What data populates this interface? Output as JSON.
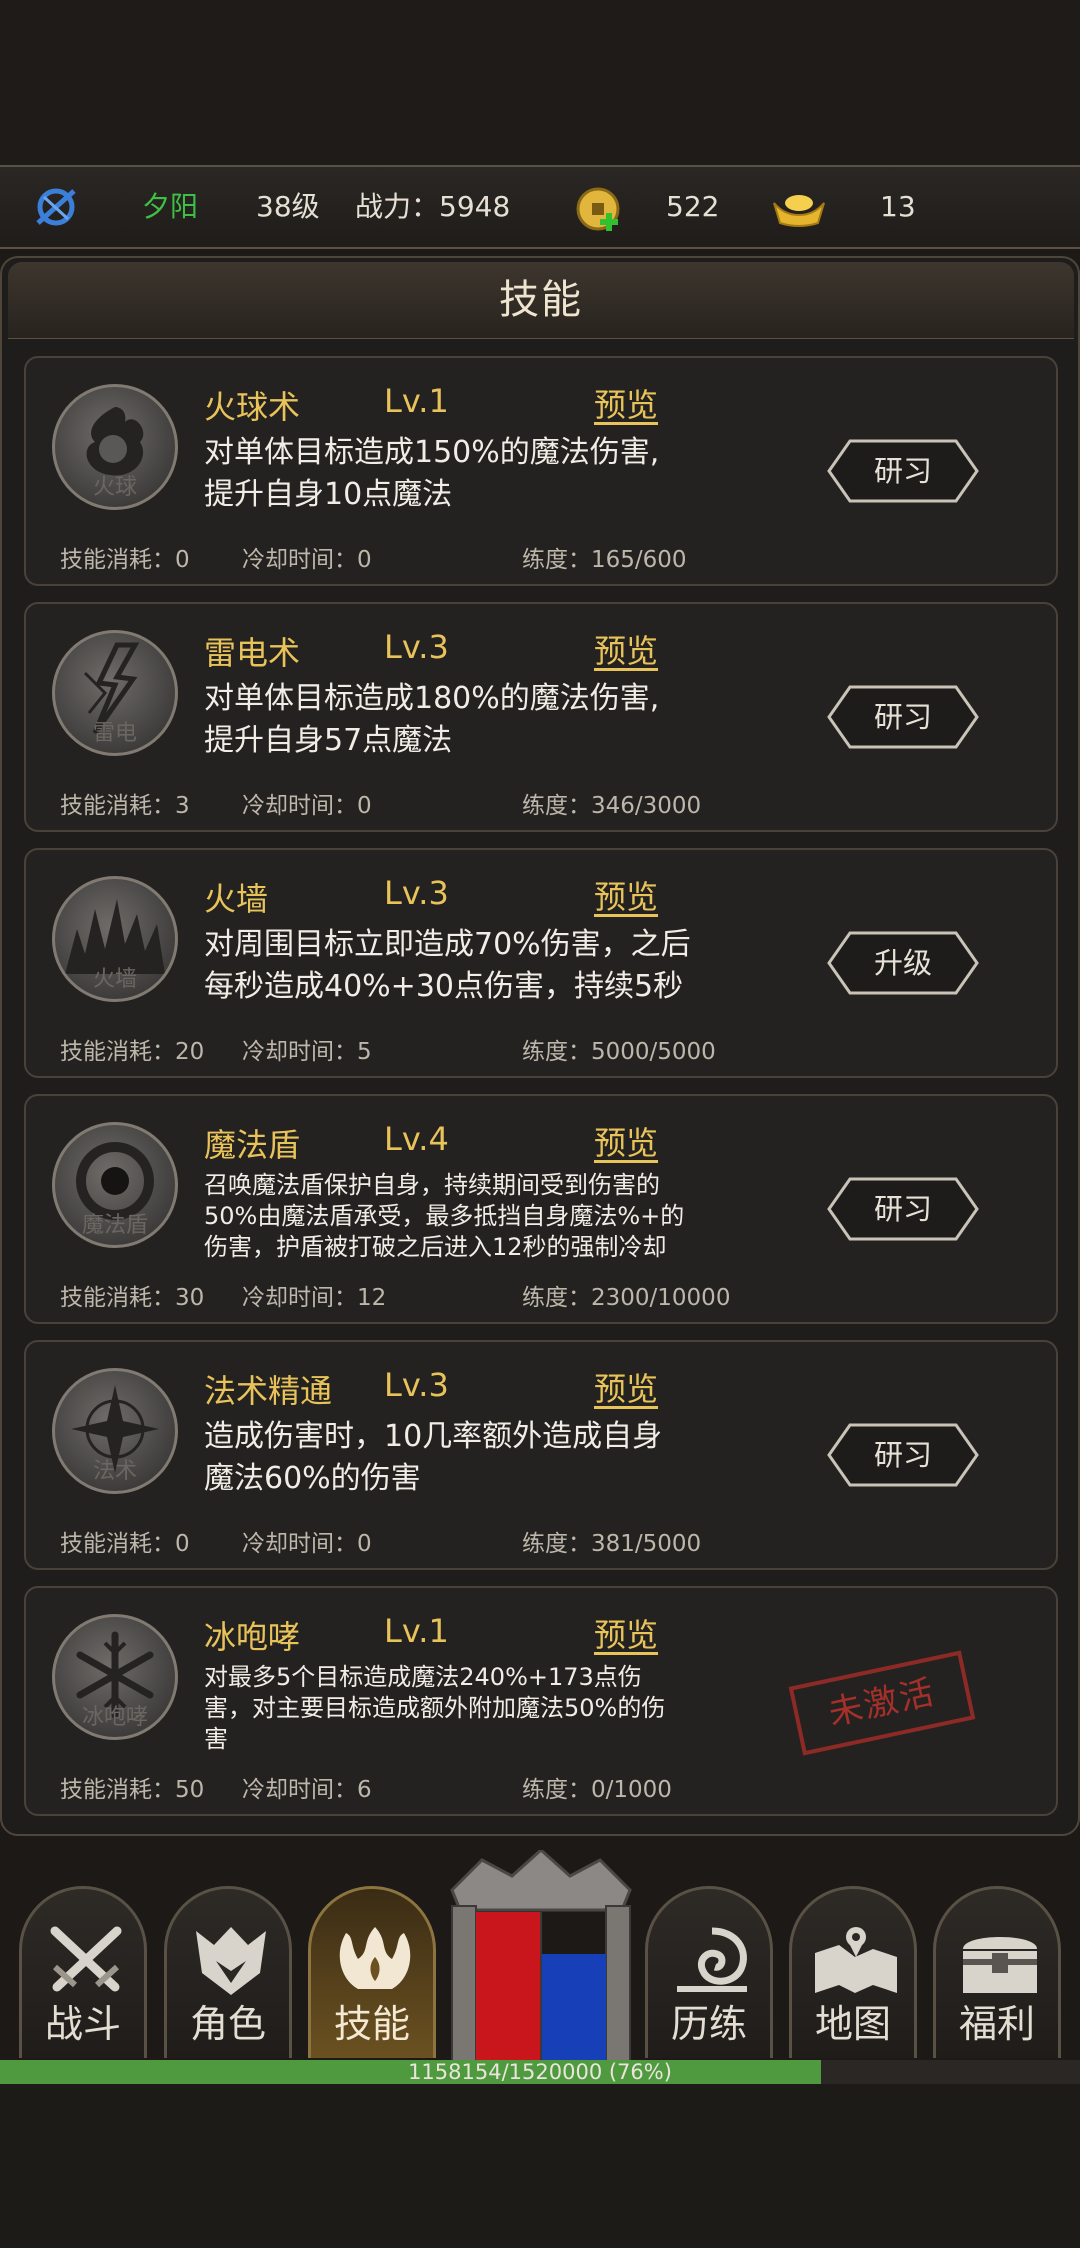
{
  "player": {
    "icon": "blue-crest-icon",
    "name": "夕阳",
    "level": "38级",
    "power_text": "战力：5948",
    "coins": "522",
    "ingots": "13"
  },
  "panel": {
    "title": "技能"
  },
  "skills": [
    {
      "name": "火球术",
      "level": "Lv.1",
      "preview": "预览",
      "icon_label": "火球",
      "icon": "fireball-icon",
      "desc_lines": [
        "对单体目标造成150%的魔法伤害,",
        "提升自身10点魔法"
      ],
      "cost": "技能消耗：0",
      "cooldown": "冷却时间：0",
      "proficiency": "练度：165/600",
      "action": "研习"
    },
    {
      "name": "雷电术",
      "level": "Lv.3",
      "preview": "预览",
      "icon_label": "雷电",
      "icon": "lightning-icon",
      "desc_lines": [
        "对单体目标造成180%的魔法伤害,",
        "提升自身57点魔法"
      ],
      "cost": "技能消耗：3",
      "cooldown": "冷却时间：0",
      "proficiency": "练度：346/3000",
      "action": "研习"
    },
    {
      "name": "火墙",
      "level": "Lv.3",
      "preview": "预览",
      "icon_label": "火墙",
      "icon": "firewall-icon",
      "desc_lines": [
        "对周围目标立即造成70%伤害，之后",
        "每秒造成40%+30点伤害，持续5秒"
      ],
      "cost": "技能消耗：20",
      "cooldown": "冷却时间：5",
      "proficiency": "练度：5000/5000",
      "action": "升级"
    },
    {
      "name": "魔法盾",
      "level": "Lv.4",
      "preview": "预览",
      "icon_label": "魔法盾",
      "icon": "magic-shield-icon",
      "desc_lines": [
        "召唤魔法盾保护自身，持续期间受到伤害的",
        "50%由魔法盾承受，最多抵挡自身魔法%+的",
        "伤害，护盾被打破之后进入12秒的强制冷却"
      ],
      "cost": "技能消耗：30",
      "cooldown": "冷却时间：12",
      "proficiency": "练度：2300/10000",
      "action": "研习"
    },
    {
      "name": "法术精通",
      "level": "Lv.3",
      "preview": "预览",
      "icon_label": "法术",
      "icon": "spell-mastery-icon",
      "desc_lines": [
        "造成伤害时，10几率额外造成自身",
        "魔法60%的伤害"
      ],
      "cost": "技能消耗：0",
      "cooldown": "冷却时间：0",
      "proficiency": "练度：381/5000",
      "action": "研习"
    },
    {
      "name": "冰咆哮",
      "level": "Lv.1",
      "preview": "预览",
      "icon_label": "冰咆哮",
      "icon": "ice-roar-icon",
      "desc_lines": [
        "对最多5个目标造成魔法240%+173点伤",
        "害，对主要目标造成额外附加魔法50%的伤",
        "害"
      ],
      "cost": "技能消耗：50",
      "cooldown": "冷却时间：6",
      "proficiency": "练度：0/1000",
      "status_stamp": "未激活"
    }
  ],
  "nav": {
    "tabs": [
      {
        "label": "战斗",
        "icon": "crossed-swords-icon"
      },
      {
        "label": "角色",
        "icon": "helmet-icon"
      },
      {
        "label": "技能",
        "icon": "flame-crest-icon",
        "active": true
      },
      {
        "label": "历练",
        "icon": "vortex-icon"
      },
      {
        "label": "地图",
        "icon": "map-icon"
      },
      {
        "label": "福利",
        "icon": "treasure-chest-icon"
      }
    ],
    "center": {
      "icon": "hp-mp-gate-icon",
      "hp_color": "#c8161c",
      "mp_color": "#1740b8"
    }
  },
  "exp": {
    "text": "1158154/1520000 (76%)",
    "fraction": 0.76
  },
  "colors": {
    "gold": "#e8c35a",
    "green_name": "#3fbf45",
    "exp_fill": "#4f9a3e"
  }
}
